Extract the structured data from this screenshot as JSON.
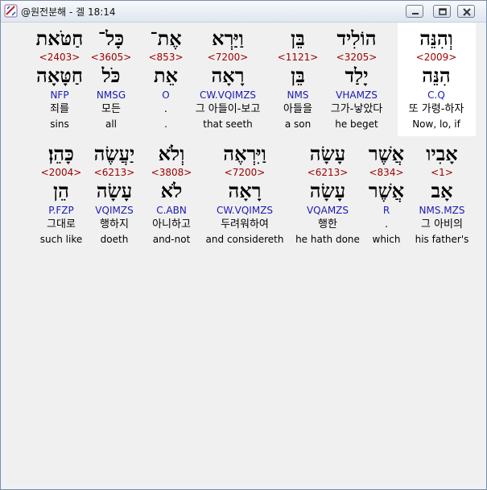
{
  "window": {
    "title": "@원전분해 - 겔 18:14"
  },
  "verse_rows": [
    {
      "words": [
        {
          "hebrew": "וְהִנֵּה",
          "strong": "<2009>",
          "lemma": "הִנֵּה",
          "morph": "C.Q",
          "korean": "또 가령-하자",
          "english": "Now, lo, if"
        },
        {
          "hebrew": "הוֹלִיד",
          "strong": "<3205>",
          "lemma": "יָלַד",
          "morph": "VHAMZS",
          "korean": "그가-낳았다",
          "english": "he beget"
        },
        {
          "hebrew": "בֵּן",
          "strong": "<1121>",
          "lemma": "בֵּן",
          "morph": "NMS",
          "korean": "아들을",
          "english": "a son"
        },
        {
          "hebrew": "וַיַּרְא",
          "strong": "<7200>",
          "lemma": "רָאָה",
          "morph": "CW.VQIMZS",
          "korean": "그 아들이-보고",
          "english": "that seeth"
        },
        {
          "hebrew": "אֶת־",
          "strong": "<853>",
          "lemma": "אֵת",
          "morph": "O",
          "korean": ".",
          "english": "."
        },
        {
          "hebrew": "כָּל־",
          "strong": "<3605>",
          "lemma": "כֹּל",
          "morph": "NMSG",
          "korean": "모든",
          "english": "all"
        },
        {
          "hebrew": "חַטֹּאת",
          "strong": "<2403>",
          "lemma": "חַטָּאָה",
          "morph": "NFP",
          "korean": "죄를",
          "english": "sins"
        }
      ]
    },
    {
      "words": [
        {
          "hebrew": "אָבִיו",
          "strong": "<1>",
          "lemma": "אָב",
          "morph": "NMS.MZS",
          "korean": "그 아비의",
          "english": "his father's"
        },
        {
          "hebrew": "אֲשֶׁר",
          "strong": "<834>",
          "lemma": "אֲשֶׁר",
          "morph": "R",
          "korean": ".",
          "english": "which"
        },
        {
          "hebrew": "עָשָׂה",
          "strong": "<6213>",
          "lemma": "עָשָׂה",
          "morph": "VQAMZS",
          "korean": "행한",
          "english": "he hath done"
        },
        {
          "hebrew": "וַיִּרְאֶה",
          "strong": "<7200>",
          "lemma": "רָאָה",
          "morph": "CW.VQIMZS",
          "korean": "두려워하여",
          "english": "and considereth"
        },
        {
          "hebrew": "וְלֹא",
          "strong": "<3808>",
          "lemma": "לֹא",
          "morph": "C.ABN",
          "korean": "아니하고",
          "english": "and-not"
        },
        {
          "hebrew": "יַעֲשֶׂה",
          "strong": "<6213>",
          "lemma": "עָשָׂה",
          "morph": "VQIMZS",
          "korean": "행하지",
          "english": "doeth"
        },
        {
          "hebrew": "כָּהֵן׃",
          "strong": "<2004>",
          "lemma": "הֵן",
          "morph": "P.FZP",
          "korean": "그대로",
          "english": "such like"
        }
      ]
    }
  ],
  "colors": {
    "strong": "#a00000",
    "morph": "#1a1ab4",
    "text": "#000000",
    "highlight": "#ffffff"
  },
  "icons": {
    "app": "dictionary-icon",
    "minimize": "minimize-icon",
    "maximize": "maximize-icon",
    "close": "close-icon"
  }
}
